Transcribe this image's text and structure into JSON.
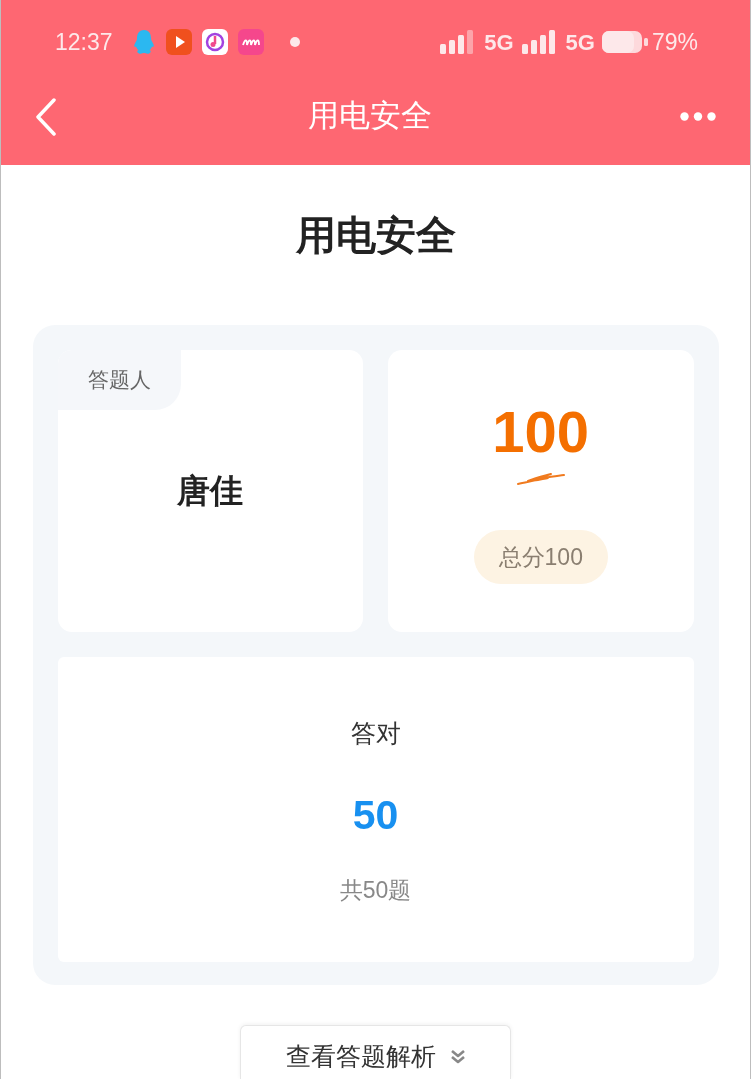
{
  "status_bar": {
    "time": "12:37",
    "signals": [
      {
        "label": "5G"
      },
      {
        "label": "5G"
      }
    ],
    "battery": "79%"
  },
  "nav_bar": {
    "title": "用电安全"
  },
  "page_title": "用电安全",
  "respondent_card": {
    "tag": "答题人",
    "name": "唐佳"
  },
  "score_card": {
    "score": "100",
    "total": "总分100"
  },
  "correct_card": {
    "label": "答对",
    "count": "50",
    "total": "共50题"
  },
  "analysis_button": {
    "label": "查看答题解析"
  }
}
